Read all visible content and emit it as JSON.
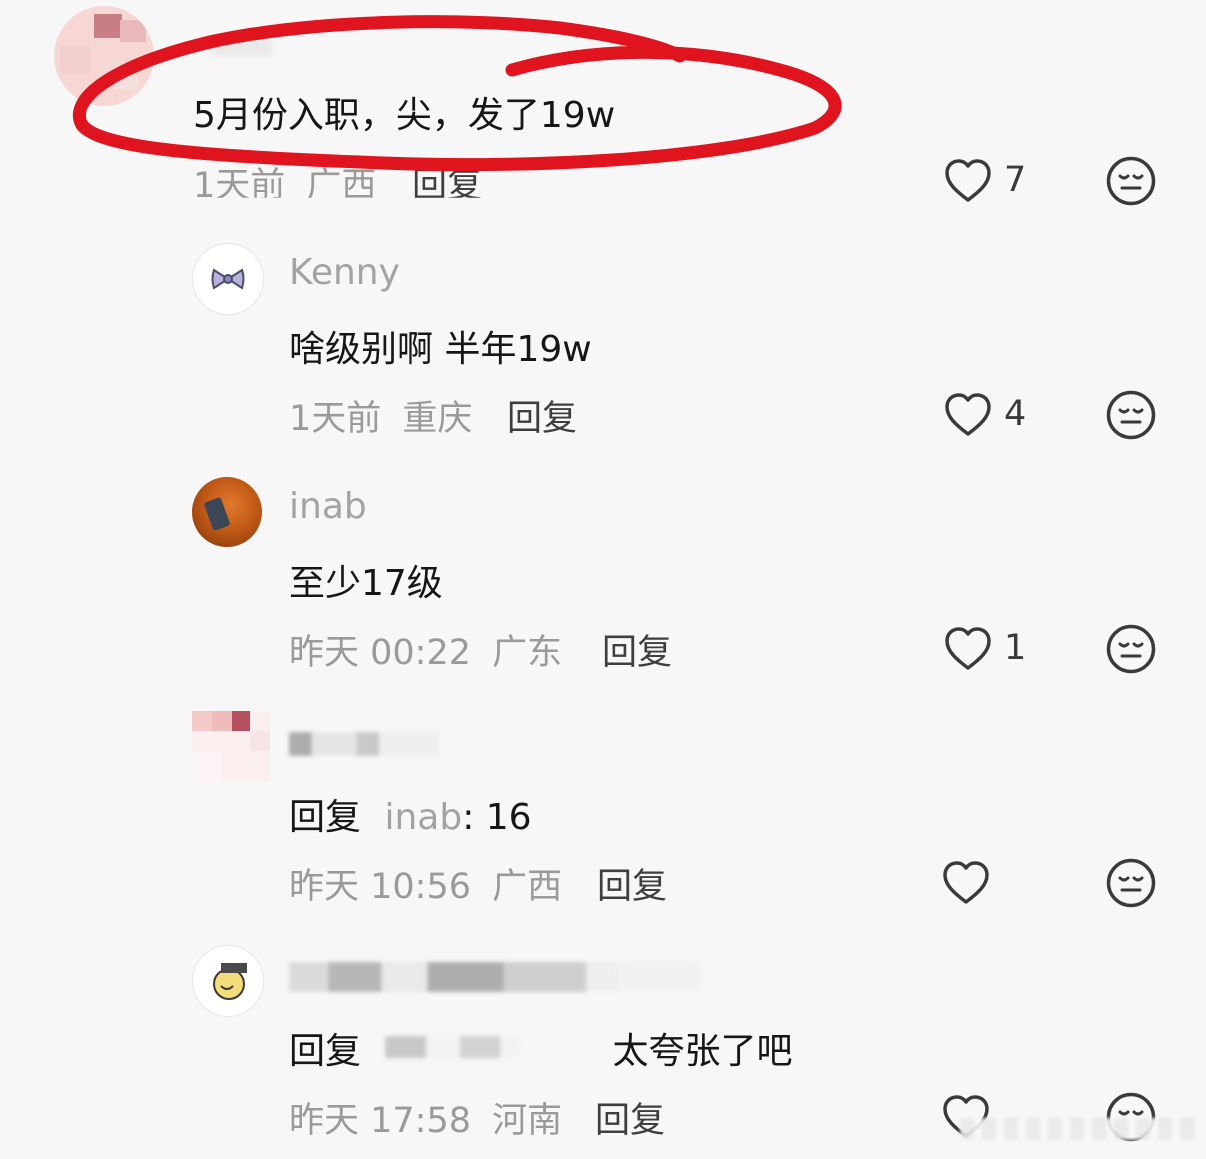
{
  "comments": [
    {
      "text": "5月份入职，尖，发了19w",
      "time": "1天前",
      "location": "广西",
      "reply_label": "回复",
      "likes": "7"
    },
    {
      "username": "Kenny",
      "text": "啥级别啊 半年19w",
      "time": "1天前",
      "location": "重庆",
      "reply_label": "回复",
      "likes": "4"
    },
    {
      "username": "inab",
      "text": "至少17级",
      "time": "昨天 00:22",
      "location": "广东",
      "reply_label": "回复",
      "likes": "1"
    },
    {
      "reply_prefix": "回复",
      "reply_target": "inab",
      "text_suffix": ": 16",
      "time": "昨天 10:56",
      "location": "广西",
      "reply_label": "回复",
      "likes": ""
    },
    {
      "reply_prefix": "回复",
      "text_suffix": "太夸张了吧",
      "time": "昨天 17:58",
      "location": "河南",
      "reply_label": "回复",
      "likes": ""
    }
  ],
  "colors": {
    "annotation_red": "#e0141e",
    "text_primary": "#161616",
    "text_secondary": "#9a9a9a",
    "icon": "#3a3a3a"
  },
  "icons": [
    "heart-icon",
    "meh-face-icon",
    "bow-icon"
  ]
}
